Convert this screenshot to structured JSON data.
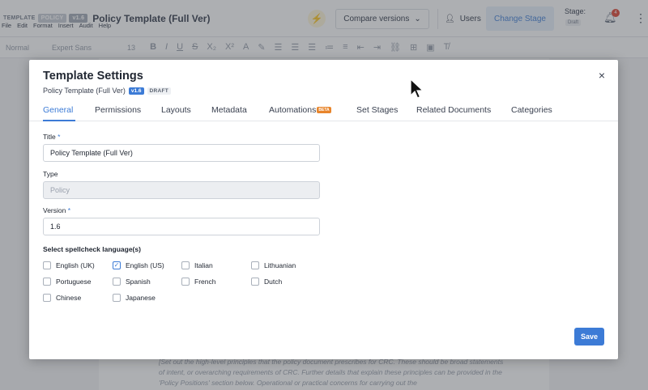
{
  "app": {
    "doc_type_chip": "TEMPLATE",
    "type_chip": "POLICY",
    "version_chip": "v1.6",
    "doc_title": "Policy Template (Full Ver)",
    "compare_label": "Compare versions",
    "users_label": "Users",
    "change_stage_label": "Change Stage",
    "stage_label": "Stage:",
    "stage_value": "Draft",
    "notifications_count": "4",
    "menu": [
      "File",
      "Edit",
      "Format",
      "Insert",
      "Audit",
      "Help"
    ],
    "format": {
      "style": "Normal",
      "font": "Expert Sans",
      "size": "13"
    },
    "doc_paragraph": "[Set out the high-level principles that the policy document prescribes for CRC. These should be broad statements of intent, or overarching requirements of CRC. Further details that explain these principles can be provided in the 'Policy Positions' section below. Operational or practical concerns for carrying out the"
  },
  "modal": {
    "title": "Template Settings",
    "subtitle": "Policy Template (Full Ver)",
    "version_badge": "v1.6",
    "status_badge": "DRAFT",
    "tabs": [
      {
        "label": "General"
      },
      {
        "label": "Permissions"
      },
      {
        "label": "Layouts"
      },
      {
        "label": "Metadata"
      },
      {
        "label": "Automations",
        "badge": "BETA"
      },
      {
        "label": "Set Stages"
      },
      {
        "label": "Related Documents"
      },
      {
        "label": "Categories"
      }
    ],
    "fields": {
      "title_label": "Title",
      "title_value": "Policy Template (Full Ver)",
      "type_label": "Type",
      "type_value": "Policy",
      "version_label": "Version",
      "version_value": "1.6",
      "required_mark": "*"
    },
    "spellcheck": {
      "heading": "Select spellcheck language(s)",
      "languages": [
        {
          "label": "English (UK)",
          "checked": false
        },
        {
          "label": "English (US)",
          "checked": true
        },
        {
          "label": "Italian",
          "checked": false
        },
        {
          "label": "Lithuanian",
          "checked": false
        },
        {
          "label": "Portuguese",
          "checked": false
        },
        {
          "label": "Spanish",
          "checked": false
        },
        {
          "label": "French",
          "checked": false
        },
        {
          "label": "Dutch",
          "checked": false
        },
        {
          "label": "Chinese",
          "checked": false
        },
        {
          "label": "Japanese",
          "checked": false
        }
      ]
    },
    "save_label": "Save",
    "close_glyph": "×"
  },
  "colors": {
    "accent": "#3c7bd6",
    "beta": "#e8852c",
    "notification": "#e04a3a"
  }
}
